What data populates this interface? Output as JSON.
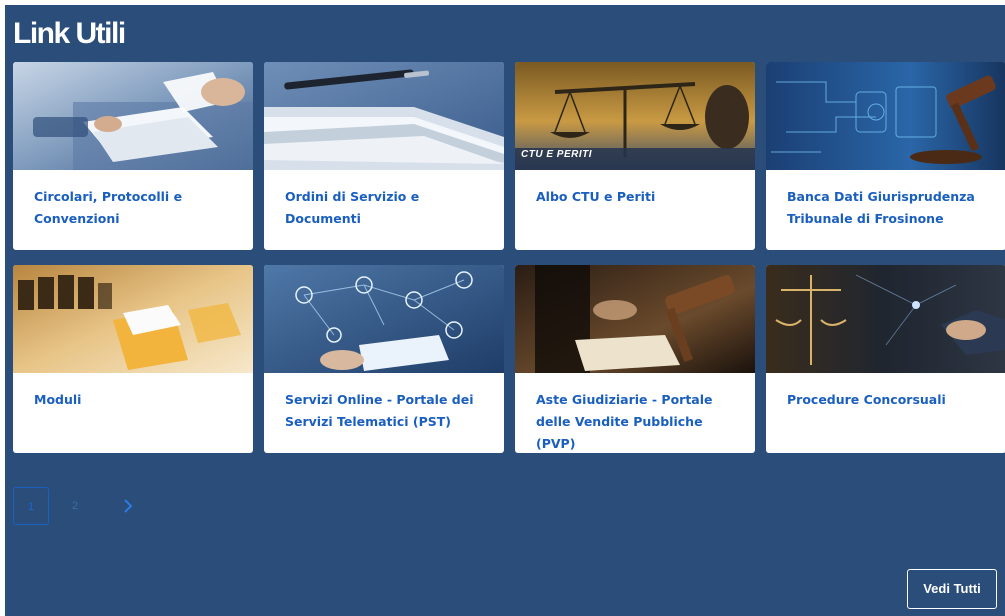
{
  "section": {
    "title": "Link Utili"
  },
  "cards": [
    {
      "label": "Circolari, Protocolli e Convenzioni",
      "image": "business-documents-image"
    },
    {
      "label": "Ordini di Servizio e Documenti",
      "image": "paper-stack-pen-image"
    },
    {
      "label": "Albo CTU e Periti",
      "image": "justice-scales-image",
      "image_caption": "CTU E PERITI"
    },
    {
      "label": "Banca Dati Giurisprudenza Tribunale di Frosinone",
      "image": "digital-gavel-image"
    },
    {
      "label": "Moduli",
      "image": "file-folders-image"
    },
    {
      "label": "Servizi Online - Portale dei Servizi Telematici (PST)",
      "image": "network-tablet-image"
    },
    {
      "label": "Aste Giudiziarie - Portale delle Vendite Pubbliche (PVP)",
      "image": "auction-gavel-image"
    },
    {
      "label": "Procedure Concorsuali",
      "image": "handshake-scales-image"
    }
  ],
  "pagination": {
    "pages": [
      "1",
      "2"
    ],
    "current": "1",
    "next_icon": "chevron-right-icon"
  },
  "view_all": {
    "label": "Vedi Tutti"
  },
  "colors": {
    "background": "#2a4d7a",
    "card": "#ffffff",
    "link": "#1a5fbf",
    "accent": "#1b5fc1"
  }
}
